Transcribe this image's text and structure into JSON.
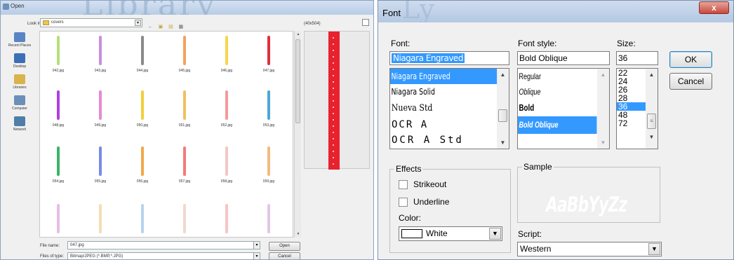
{
  "open_dialog": {
    "title": "Open",
    "look_in_label": "Look in:",
    "look_in_value": "covers",
    "file_size_label": "(40x504)",
    "places": [
      {
        "label": "Recent Places",
        "icon": "recent-places-icon",
        "color": "#5b84c4"
      },
      {
        "label": "Desktop",
        "icon": "desktop-icon",
        "color": "#3c6fb6"
      },
      {
        "label": "Libraries",
        "icon": "libraries-icon",
        "color": "#d9b34c"
      },
      {
        "label": "Computer",
        "icon": "computer-icon",
        "color": "#6b8fb8"
      },
      {
        "label": "Network",
        "icon": "network-icon",
        "color": "#4f7fa8"
      }
    ],
    "files": [
      {
        "name": "042.jpg",
        "color": "#b6df7a"
      },
      {
        "name": "043.jpg",
        "color": "#c98ee0"
      },
      {
        "name": "044.jpg",
        "color": "#8a8a8a"
      },
      {
        "name": "045.jpg",
        "color": "#f3a25c"
      },
      {
        "name": "046.jpg",
        "color": "#f5d64d"
      },
      {
        "name": "047.jpg",
        "color": "#e0303c"
      },
      {
        "name": "048.jpg",
        "color": "#b040e0"
      },
      {
        "name": "049.jpg",
        "color": "#e58ad2"
      },
      {
        "name": "050.jpg",
        "color": "#f2cf3c"
      },
      {
        "name": "051.jpg",
        "color": "#f0c060"
      },
      {
        "name": "052.jpg",
        "color": "#f39a9a"
      },
      {
        "name": "053.jpg",
        "color": "#4da7d4"
      },
      {
        "name": "054.jpg",
        "color": "#3cb36a"
      },
      {
        "name": "055.jpg",
        "color": "#7a8be6"
      },
      {
        "name": "056.jpg",
        "color": "#f0a94a"
      },
      {
        "name": "057.jpg",
        "color": "#f57a7a"
      },
      {
        "name": "058.jpg",
        "color": "#f2c6c6"
      },
      {
        "name": "059.jpg",
        "color": "#f5b97d"
      },
      {
        "name": "",
        "color": "#e6bde8"
      },
      {
        "name": "",
        "color": "#f4dfb3"
      },
      {
        "name": "",
        "color": "#b6d4ef"
      },
      {
        "name": "",
        "color": "#f0d8cc"
      },
      {
        "name": "",
        "color": "#f5c5c5"
      },
      {
        "name": "",
        "color": "#e3c5e8"
      }
    ],
    "file_name_label": "File name:",
    "file_name_value": "047.jpg",
    "files_of_type_label": "Files of type:",
    "files_of_type_value": "Bitmap/JPEG (*.BMP,*.JPG)",
    "open_button": "Open",
    "cancel_button": "Cancel",
    "preview_color": "#e8212f"
  },
  "font_dialog": {
    "title": "Font",
    "close_glyph": "x",
    "font_label": "Font:",
    "font_value": "Niagara Engraved",
    "font_list": [
      {
        "name": "Niagara Engraved",
        "selected": true
      },
      {
        "name": "Niagara Solid",
        "selected": false
      },
      {
        "name": "Nueva Std",
        "selected": false
      },
      {
        "name": "OCR A",
        "selected": false
      },
      {
        "name": "OCR A Std",
        "selected": false
      }
    ],
    "style_label": "Font style:",
    "style_value": "Bold Oblique",
    "style_list": [
      {
        "name": "Regular",
        "selected": false
      },
      {
        "name": "Oblique",
        "selected": false
      },
      {
        "name": "Bold",
        "selected": false
      },
      {
        "name": "Bold Oblique",
        "selected": true
      }
    ],
    "size_label": "Size:",
    "size_value": "36",
    "size_list": [
      {
        "name": "22",
        "selected": false
      },
      {
        "name": "24",
        "selected": false
      },
      {
        "name": "26",
        "selected": false
      },
      {
        "name": "28",
        "selected": false
      },
      {
        "name": "36",
        "selected": true
      },
      {
        "name": "48",
        "selected": false
      },
      {
        "name": "72",
        "selected": false
      }
    ],
    "ok_button": "OK",
    "cancel_button": "Cancel",
    "effects_label": "Effects",
    "strikeout_label": "Strikeout",
    "strikeout_checked": false,
    "underline_label": "Underline",
    "underline_checked": false,
    "color_label": "Color:",
    "color_value": "White",
    "sample_label": "Sample",
    "sample_text": "AaBbYyZz",
    "script_label": "Script:",
    "script_value": "Western",
    "selection_color": "#3399ff"
  }
}
